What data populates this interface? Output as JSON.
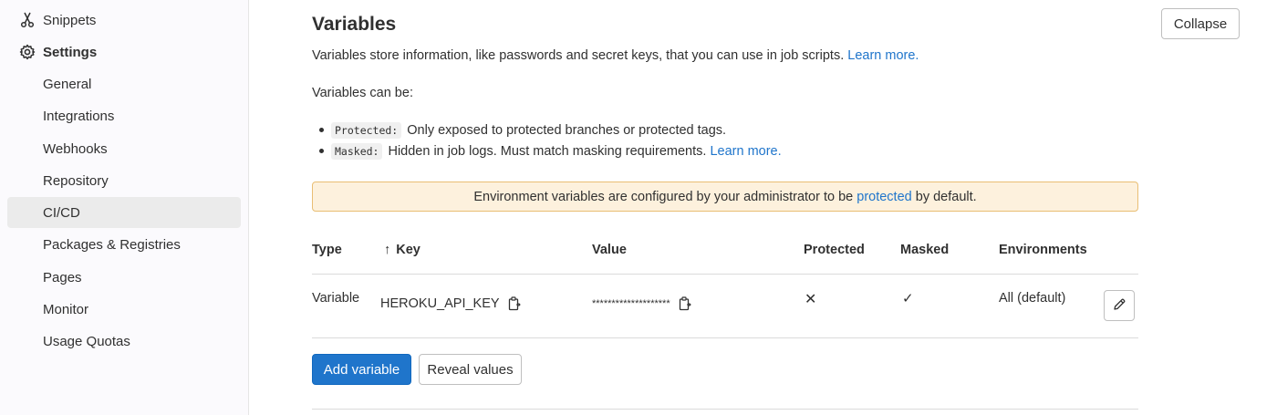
{
  "sidebar": {
    "items": [
      {
        "label": "Snippets",
        "icon": "snippet-icon"
      },
      {
        "label": "Settings",
        "icon": "gear-icon"
      },
      {
        "label": "General"
      },
      {
        "label": "Integrations"
      },
      {
        "label": "Webhooks"
      },
      {
        "label": "Repository"
      },
      {
        "label": "CI/CD",
        "active": true
      },
      {
        "label": "Packages & Registries"
      },
      {
        "label": "Pages"
      },
      {
        "label": "Monitor"
      },
      {
        "label": "Usage Quotas"
      }
    ]
  },
  "section": {
    "title": "Variables",
    "collapse_label": "Collapse",
    "description": "Variables store information, like passwords and secret keys, that you can use in job scripts.",
    "learn_more": "Learn more.",
    "can_be": "Variables can be:",
    "bullets": [
      {
        "code": "Protected:",
        "text": "Only exposed to protected branches or protected tags.",
        "link": ""
      },
      {
        "code": "Masked:",
        "text": "Hidden in job logs. Must match masking requirements.",
        "link": "Learn more."
      }
    ]
  },
  "alert": {
    "before": "Environment variables are configured by your administrator to be",
    "link": "protected",
    "after": "by default."
  },
  "table": {
    "headers": {
      "type": "Type",
      "sort_arrow": "↑",
      "key": "Key",
      "value": "Value",
      "protected": "Protected",
      "masked": "Masked",
      "environments": "Environments"
    },
    "rows": [
      {
        "type": "Variable",
        "key": "HEROKU_API_KEY",
        "value": "********************",
        "protected": "✕",
        "masked": "✓",
        "environments": "All (default)"
      }
    ]
  },
  "actions": {
    "add_variable": "Add variable",
    "reveal_values": "Reveal values"
  },
  "colors": {
    "primary": "#1f75cb",
    "alert_bg": "#fdf1dd",
    "alert_border": "#e9be74",
    "sidebar_active": "#ebebeb"
  }
}
